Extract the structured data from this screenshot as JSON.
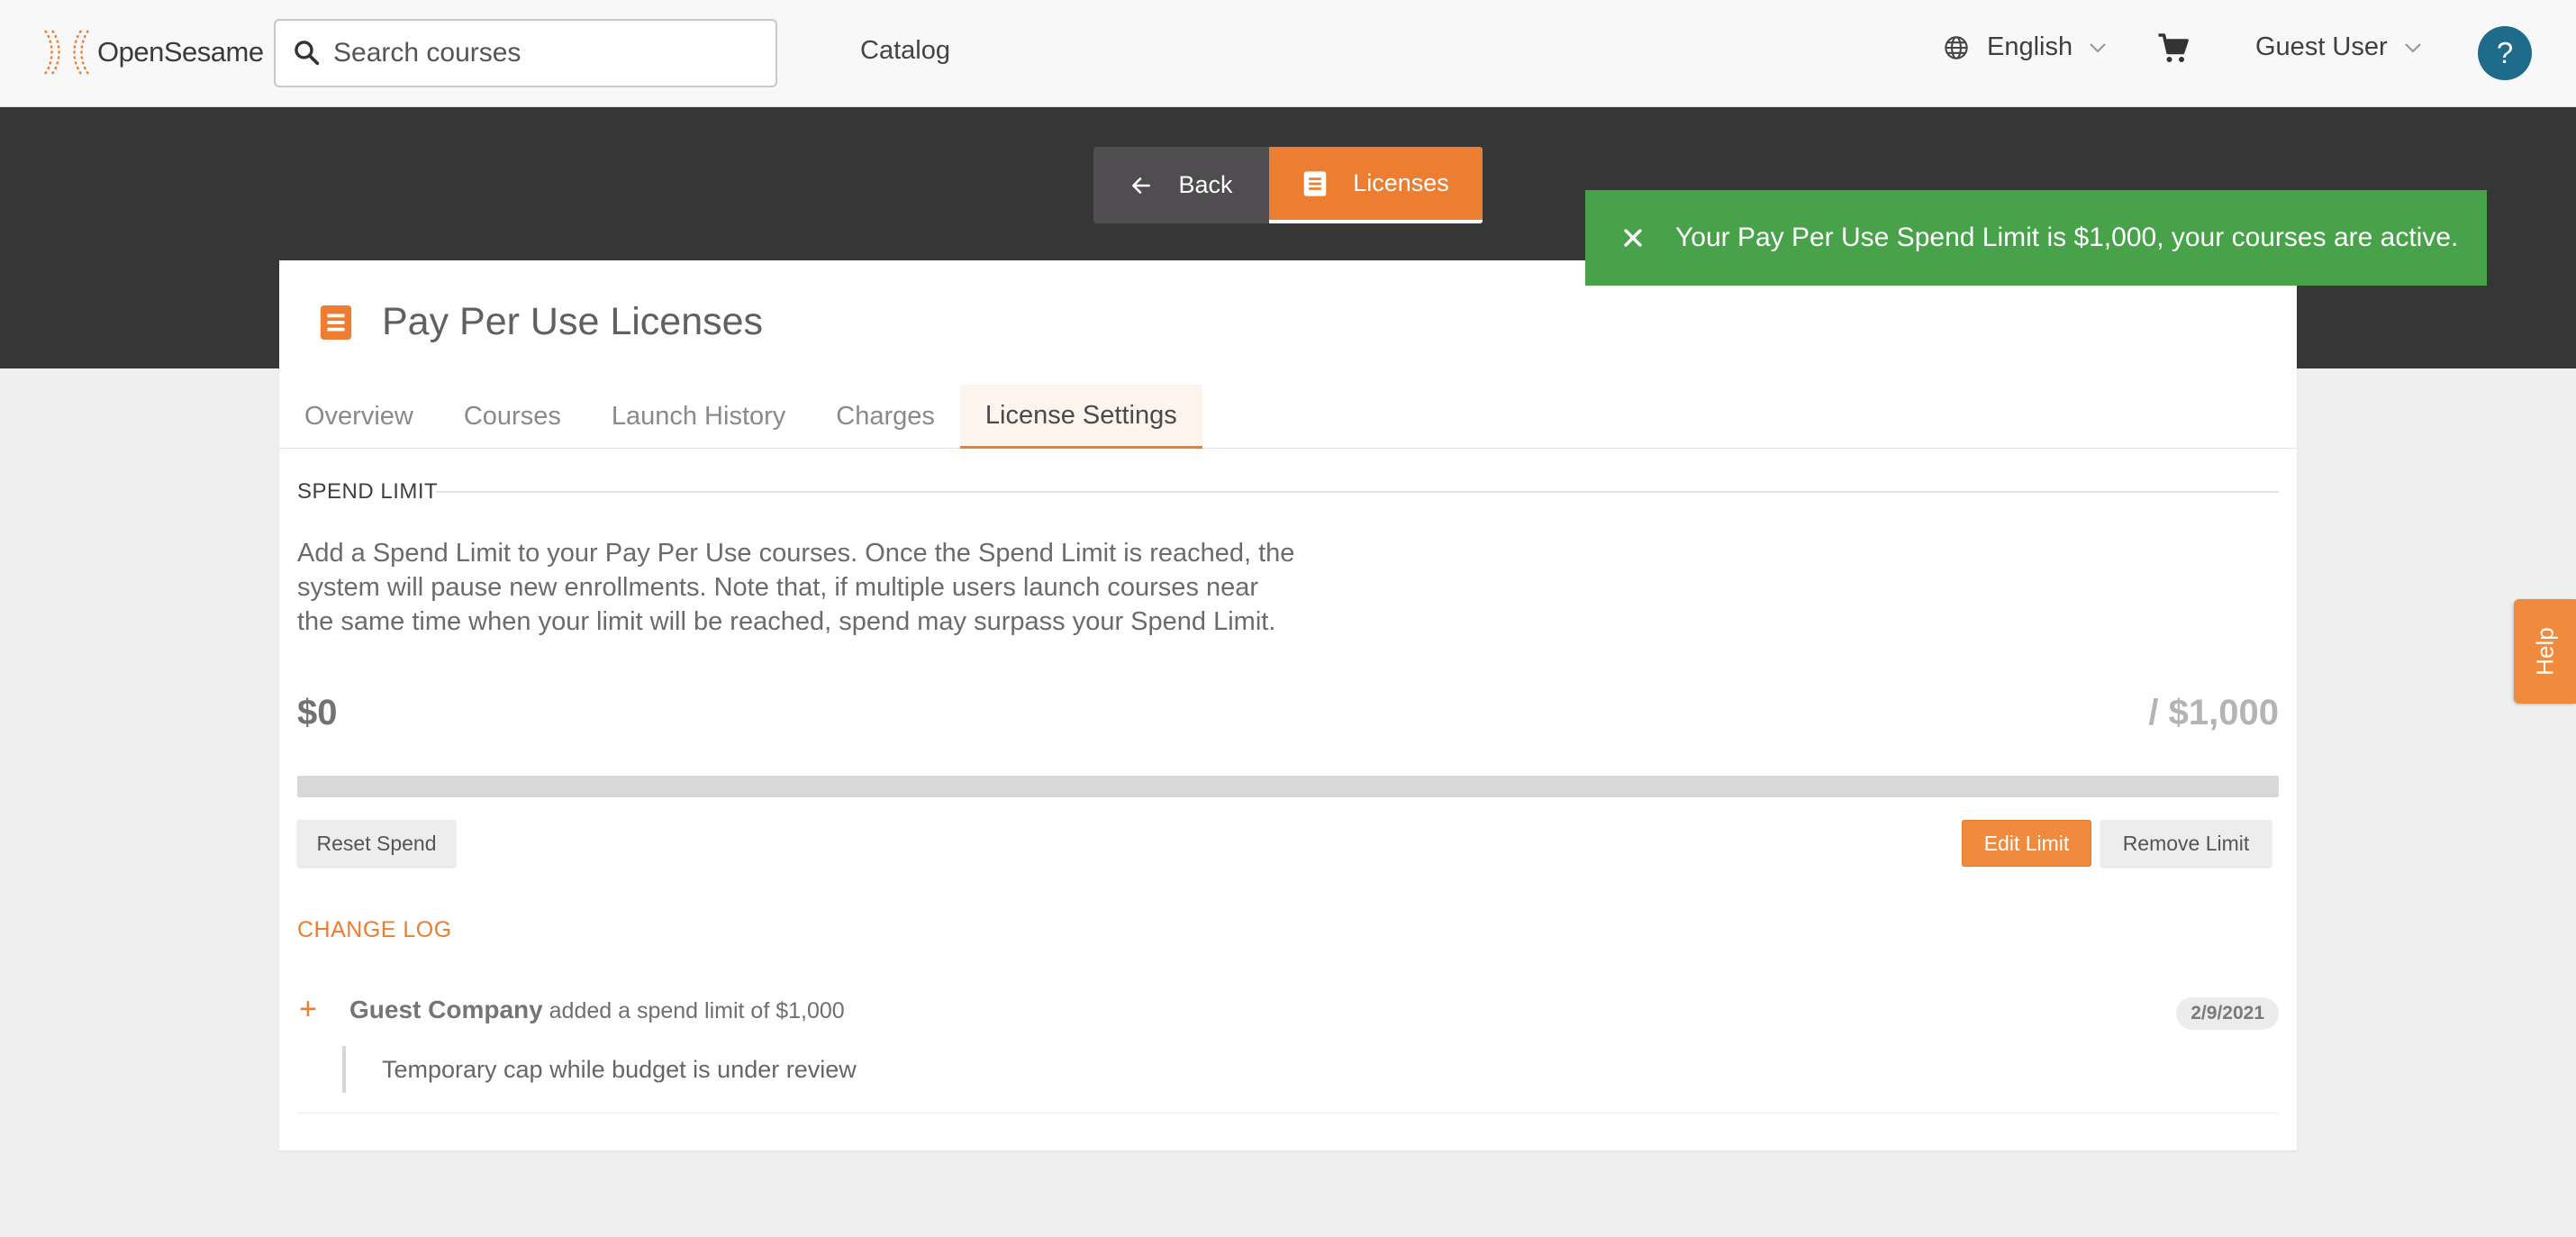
{
  "header": {
    "logo_text": "OpenSesame",
    "search_placeholder": "Search courses",
    "nav_catalog": "Catalog",
    "language": "English",
    "user": "Guest User",
    "help_circle": "?",
    "icons": [
      "opensesame-logo-icon",
      "search-icon",
      "globe-icon",
      "chevron-down-icon",
      "cart-icon"
    ]
  },
  "hero": {
    "back_label": "Back",
    "licenses_label": "Licenses"
  },
  "toast": {
    "message": "Your Pay Per Use Spend Limit is $1,000, your courses are active.",
    "color": "#48a24a"
  },
  "card": {
    "title": "Pay Per Use Licenses",
    "tabs": [
      {
        "label": "Overview",
        "active": false
      },
      {
        "label": "Courses",
        "active": false
      },
      {
        "label": "Launch History",
        "active": false
      },
      {
        "label": "Charges",
        "active": false
      },
      {
        "label": "License Settings",
        "active": true
      }
    ]
  },
  "spend_limit": {
    "section_label": "SPEND LIMIT",
    "description": "Add a Spend Limit to your Pay Per Use courses. Once the Spend Limit is reached, the system will pause new enrollments. Note that, if multiple users launch courses near the same time when your limit will be reached, spend may surpass your Spend Limit.",
    "spent": "$0",
    "limit": "/ $1,000",
    "progress_fraction": 0,
    "reset_label": "Reset Spend",
    "edit_label": "Edit Limit",
    "remove_label": "Remove Limit"
  },
  "change_log": {
    "section_label": "CHANGE LOG",
    "entries": [
      {
        "who": "Guest Company",
        "action": "added a spend limit of $1,000",
        "date": "2/9/2021",
        "note": "Temporary cap while budget is under review"
      }
    ]
  },
  "side_help": {
    "label": "Help"
  },
  "colors": {
    "accent": "#ed7d31",
    "hero_bg": "#373637",
    "help_circle": "#1f6b8c"
  }
}
